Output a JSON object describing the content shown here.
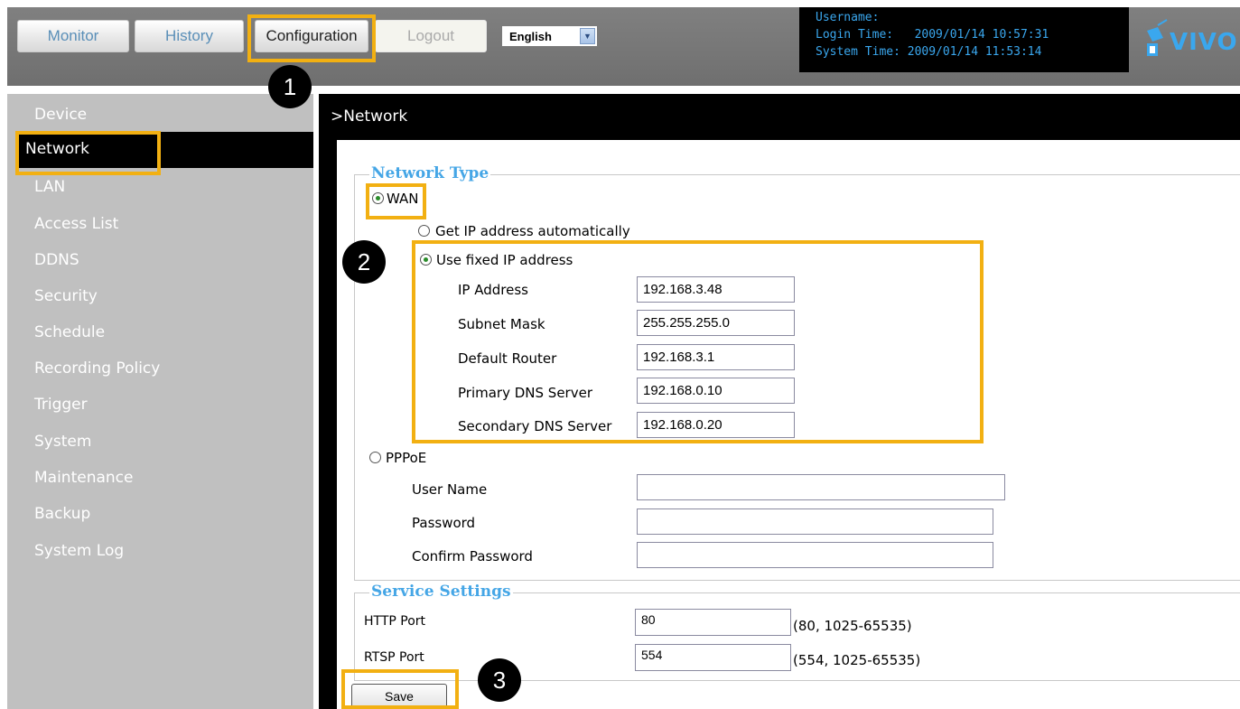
{
  "nav": {
    "monitor": "Monitor",
    "history": "History",
    "configuration": "Configuration",
    "logout": "Logout",
    "language": "English"
  },
  "info": {
    "username_label": "Username:",
    "username_value": "",
    "login_label": "Login Time:",
    "login_value": "2009/01/14 10:57:31",
    "system_label": "System Time:",
    "system_value": "2009/01/14 11:53:14"
  },
  "logo": {
    "text": "VIVO",
    "icon": "camera-logo-icon"
  },
  "sidebar": {
    "items": [
      "Device",
      "Network",
      "LAN",
      "Access List",
      "DDNS",
      "Security",
      "Schedule",
      "Recording Policy",
      "Trigger",
      "System",
      "Maintenance",
      "Backup",
      "System Log"
    ],
    "active": "Network"
  },
  "page": {
    "title": ">Network"
  },
  "network_type": {
    "legend": "Network Type",
    "wan_label": "WAN",
    "auto_label": "Get IP address automatically",
    "fixed_label": "Use fixed IP address",
    "fixed_fields": [
      {
        "label": "IP Address",
        "value": "192.168.3.48"
      },
      {
        "label": "Subnet Mask",
        "value": "255.255.255.0"
      },
      {
        "label": "Default Router",
        "value": "192.168.3.1"
      },
      {
        "label": "Primary DNS Server",
        "value": "192.168.0.10"
      },
      {
        "label": "Secondary DNS Server",
        "value": "192.168.0.20"
      }
    ],
    "pppoe_label": "PPPoE",
    "pppoe_fields": [
      {
        "label": "User Name",
        "value": ""
      },
      {
        "label": "Password",
        "value": ""
      },
      {
        "label": "Confirm Password",
        "value": ""
      }
    ]
  },
  "service": {
    "legend": "Service Settings",
    "http_label": "HTTP Port",
    "http_value": "80",
    "http_hint": "(80, 1025-65535)",
    "rtsp_label": "RTSP Port",
    "rtsp_value": "554",
    "rtsp_hint": "(554, 1025-65535)"
  },
  "save_label": "Save",
  "callouts": [
    "1",
    "2",
    "3"
  ],
  "colors": {
    "highlight": "#f2b012",
    "accent": "#45a6e6",
    "info_text": "#3aa7ee"
  }
}
